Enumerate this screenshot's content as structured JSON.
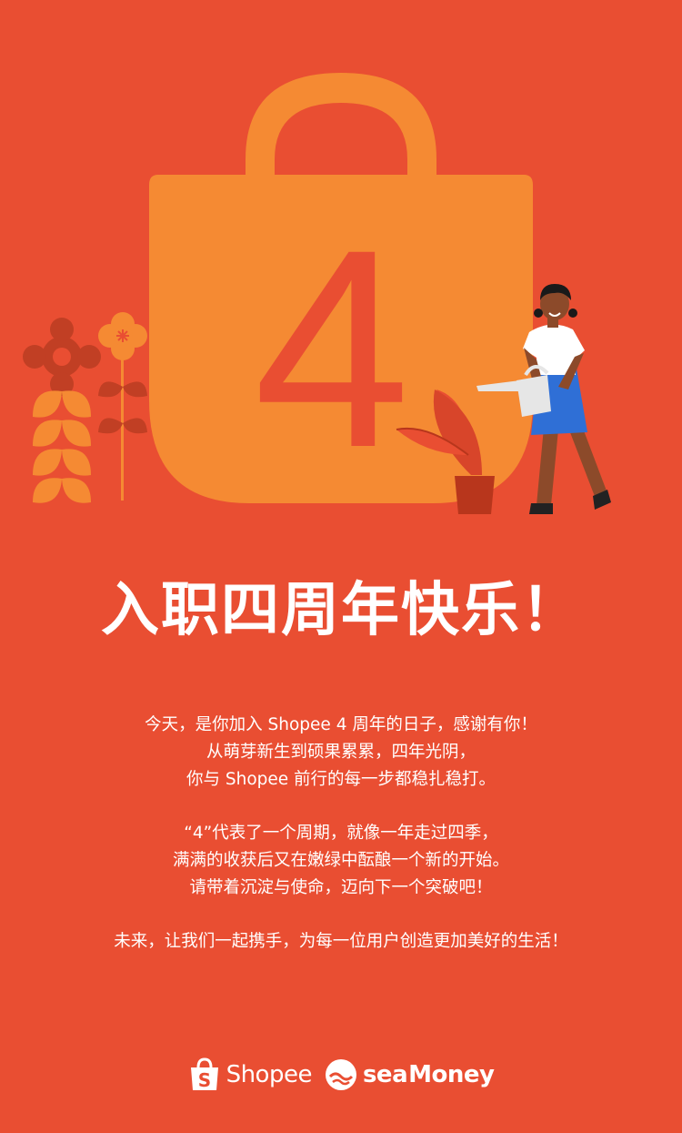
{
  "colors": {
    "background": "#E94E32",
    "bag": "#F58A33",
    "numeral": "#E94E32",
    "text": "#FFFFFF",
    "shirt": "#FFFFFF",
    "skirt": "#2F6FD6",
    "pot": "#B8361C"
  },
  "illustration": {
    "numeral": "4",
    "icons": [
      "shopping-bag-icon",
      "flower-icon",
      "leaf-plant-icon",
      "girl-watering-icon",
      "watering-can-icon",
      "plant-pot-icon"
    ]
  },
  "headline": "入职四周年快乐！",
  "body": {
    "paragraphs": [
      [
        "今天，是你加入 Shopee 4 周年的日子，感谢有你！",
        "从萌芽新生到硕果累累，四年光阴，",
        "你与 Shopee 前行的每一步都稳扎稳打。"
      ],
      [
        "“4”代表了一个周期，就像一年走过四季，",
        "满满的收获后又在嫩绿中酝酿一个新的开始。",
        "请带着沉淀与使命，迈向下一个突破吧！"
      ],
      [
        "未来，让我们一起携手，为每一位用户创造更加美好的生活！"
      ]
    ]
  },
  "logos": {
    "shopee": "Shopee",
    "seamoney_sea": "sea",
    "seamoney_money": "Money"
  }
}
